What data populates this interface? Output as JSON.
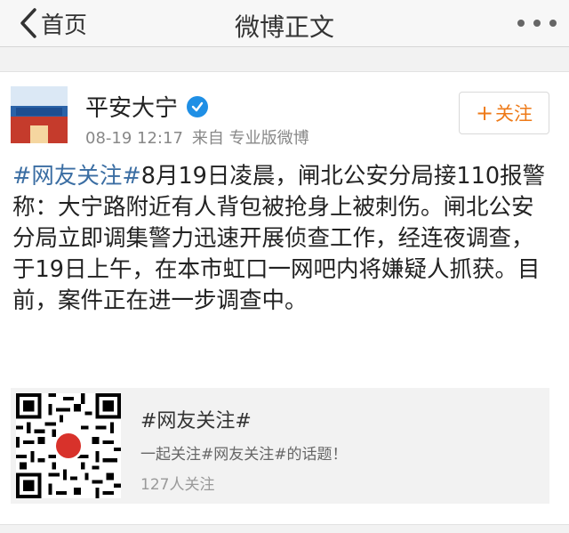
{
  "nav": {
    "back_label": "首页",
    "title": "微博正文",
    "more_icon": "more-dots-icon"
  },
  "post": {
    "author": "平安大宁",
    "verified_icon": "verified-check-icon",
    "time": "08-19 12:17",
    "source": "来自 专业版微博",
    "follow_label": "关注",
    "follow_color": "#ee7a18",
    "hashtag": "#网友关注#",
    "body": "8月19日凌晨，闸北公安分局接110报警称：大宁路附近有人背包被抢身上被刺伤。闸北公安分局立即调集警力迅速开展侦查工作，经连夜调查，于19日上午，在本市虹口一网吧内将嫌疑人抓获。目前，案件正在进一步调查中。",
    "hashtag_color": "#3b6ea3"
  },
  "topic_card": {
    "title": "#网友关注#",
    "description": "一起关注#网友关注#的话题！",
    "followers": "127人关注",
    "qr_icon": "qr-code-icon"
  }
}
